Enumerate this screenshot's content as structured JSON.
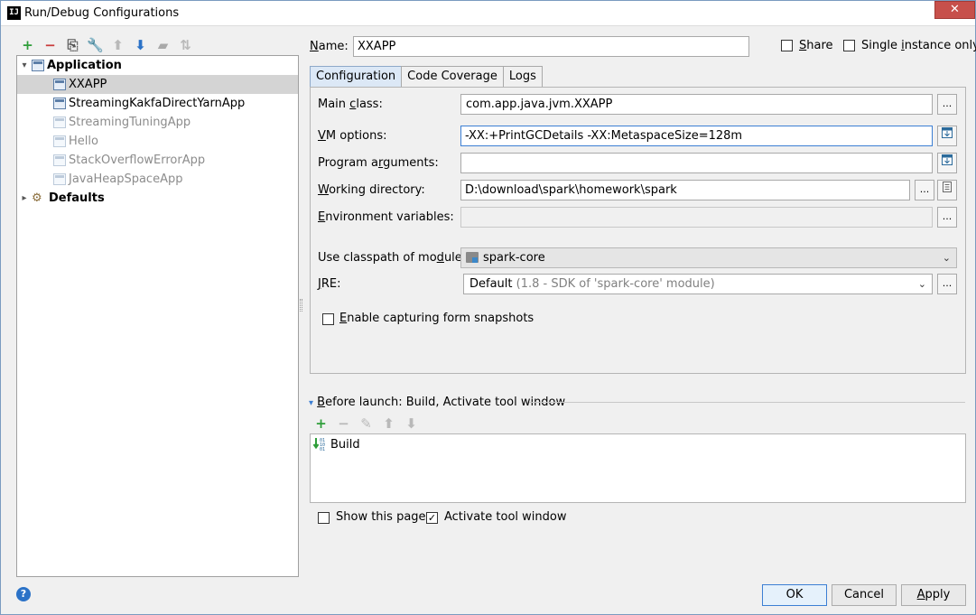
{
  "window": {
    "title": "Run/Debug Configurations",
    "app_icon": "IJ",
    "close_glyph": "✕"
  },
  "left_toolbar": [
    {
      "name": "add-icon",
      "glyph": "+",
      "color": "#2f9e3a"
    },
    {
      "name": "remove-icon",
      "glyph": "−",
      "color": "#c93b3b"
    },
    {
      "name": "copy-icon",
      "glyph": "⎘",
      "color": "#555555"
    },
    {
      "name": "edit-defaults-icon",
      "glyph": "🔧",
      "color": "#8a6d3b"
    },
    {
      "name": "move-up-icon",
      "glyph": "⬆",
      "color": "#b9b9b9"
    },
    {
      "name": "move-down-icon",
      "glyph": "⬇",
      "color": "#2b72c7"
    },
    {
      "name": "folder-icon",
      "glyph": "▰",
      "color": "#a9a9a9"
    },
    {
      "name": "sort-icon",
      "glyph": "⇅",
      "color": "#b9b9b9"
    }
  ],
  "tree": {
    "application_label": "Application",
    "items": [
      "XXAPP",
      "StreamingKakfaDirectYarnApp",
      "StreamingTuningApp",
      "Hello",
      "StackOverflowErrorApp",
      "JavaHeapSpaceApp"
    ],
    "defaults_label": "Defaults",
    "expanded_glyph": "▾",
    "collapsed_glyph": "▸"
  },
  "form": {
    "name_label_u": "N",
    "name_label_rest": "ame:",
    "name_value": "XXAPP",
    "share_label_u": "S",
    "share_label_rest": "hare",
    "single_instance_label_pre": "Single ",
    "single_instance_label_u": "i",
    "single_instance_label_rest": "nstance only",
    "tabs": [
      "Configuration",
      "Code Coverage",
      "Logs"
    ],
    "main_class_label_pre": "Main ",
    "main_class_label_u": "c",
    "main_class_label_rest": "lass:",
    "main_class_value": "com.app.java.jvm.XXAPP",
    "vm_options_label_u": "V",
    "vm_options_label_rest": "M options:",
    "vm_options_value": "-XX:+PrintGCDetails -XX:MetaspaceSize=128m",
    "program_args_label_pre": "Program a",
    "program_args_label_u": "r",
    "program_args_label_rest": "guments:",
    "program_args_value": "",
    "working_dir_label_u": "W",
    "working_dir_label_rest": "orking directory:",
    "working_dir_value": "D:\\download\\spark\\homework\\spark",
    "env_vars_label_u": "E",
    "env_vars_label_rest": "nvironment variables:",
    "env_vars_value": "",
    "classpath_label_pre": "Use classpath of mo",
    "classpath_label_u": "d",
    "classpath_label_rest": "ule:",
    "classpath_value": "spark-core",
    "jre_label_u": "J",
    "jre_label_rest": "RE:",
    "jre_value": "Default",
    "jre_hint": "(1.8 - SDK of 'spark-core' module)",
    "snapshots_label_u": "E",
    "snapshots_label_rest": "nable capturing form snapshots",
    "ellipsis": "...",
    "chevron": "⌄"
  },
  "before_launch": {
    "label_pre": "",
    "label_u": "B",
    "label_rest": "efore launch: Build, Activate tool window",
    "collapse_glyph": "▾",
    "toolbar": [
      {
        "name": "add-icon",
        "glyph": "+",
        "color": "#2f9e3a"
      },
      {
        "name": "remove-icon",
        "glyph": "−",
        "color": "#b9b9b9"
      },
      {
        "name": "edit-icon",
        "glyph": "✎",
        "color": "#b9b9b9"
      },
      {
        "name": "move-up-icon",
        "glyph": "⬆",
        "color": "#b9b9b9"
      },
      {
        "name": "move-down-icon",
        "glyph": "⬇",
        "color": "#b9b9b9"
      }
    ],
    "items": [
      "Build"
    ],
    "show_page_label": "Show this page",
    "activate_label": "Activate tool window",
    "activate_checked": true,
    "check_glyph": "✓"
  },
  "buttons": {
    "ok": "OK",
    "cancel": "Cancel",
    "apply_u": "A",
    "apply_rest": "pply"
  },
  "help_glyph": "?"
}
